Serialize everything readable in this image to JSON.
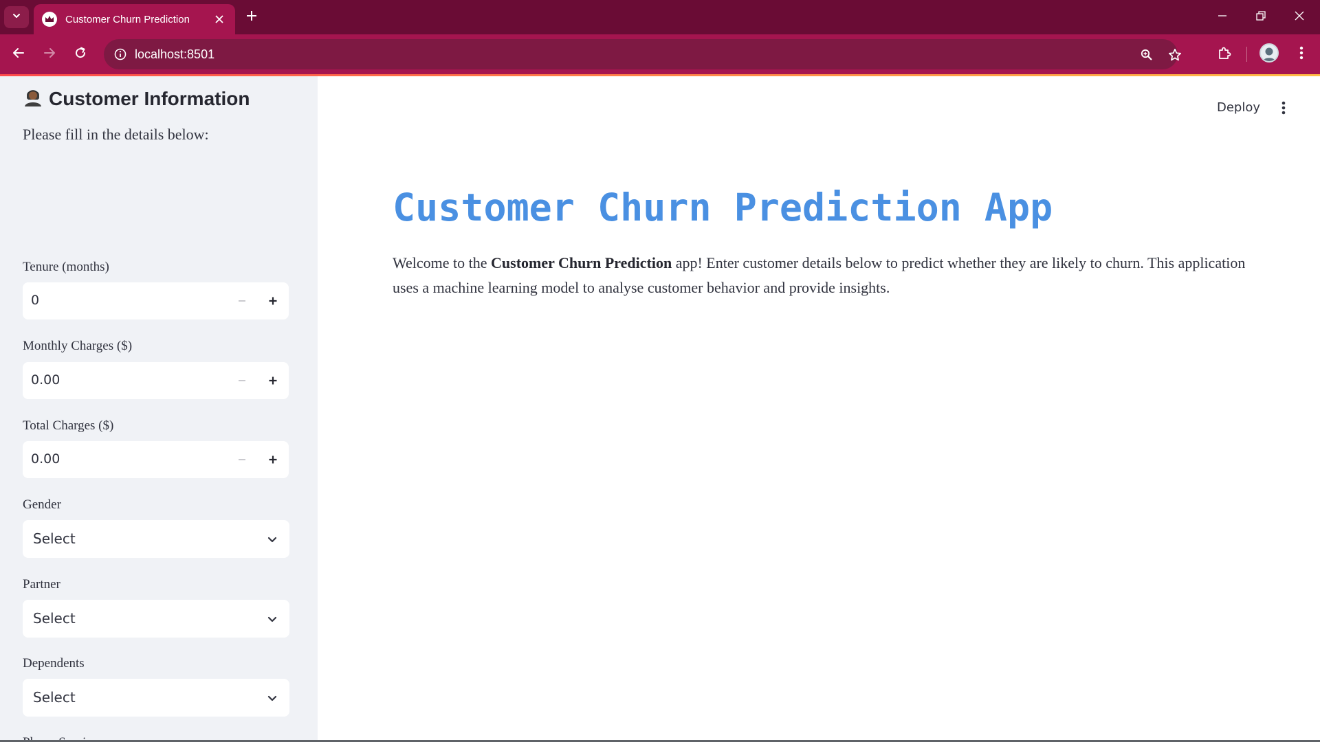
{
  "browser": {
    "tab_title": "Customer Churn Prediction",
    "url": "localhost:8501",
    "colors": {
      "frame": "#6a0c35",
      "toolbar": "#a5154f",
      "omnibox": "#7e1943"
    }
  },
  "header": {
    "deploy_label": "Deploy"
  },
  "sidebar": {
    "header_emoji_icon": "person-icon",
    "header": "Customer Information",
    "subheader": "Please fill in the details below:",
    "fields": [
      {
        "label": "Tenure (months)",
        "value": "0"
      },
      {
        "label": "Monthly Charges ($)",
        "value": "0.00"
      },
      {
        "label": "Total Charges ($)",
        "value": "0.00"
      }
    ],
    "selects": [
      {
        "label": "Gender",
        "value": "Select"
      },
      {
        "label": "Partner",
        "value": "Select"
      },
      {
        "label": "Dependents",
        "value": "Select"
      }
    ],
    "cut_off_label": "Phone Service"
  },
  "main": {
    "title": "Customer Churn Prediction App",
    "title_color": "#4a90e2",
    "intro_before": "Welcome to the ",
    "intro_bold": "Customer Churn Prediction",
    "intro_after": " app! Enter customer details below to predict whether they are likely to churn. This application uses a machine learning model to analyse customer behavior and provide insights."
  }
}
